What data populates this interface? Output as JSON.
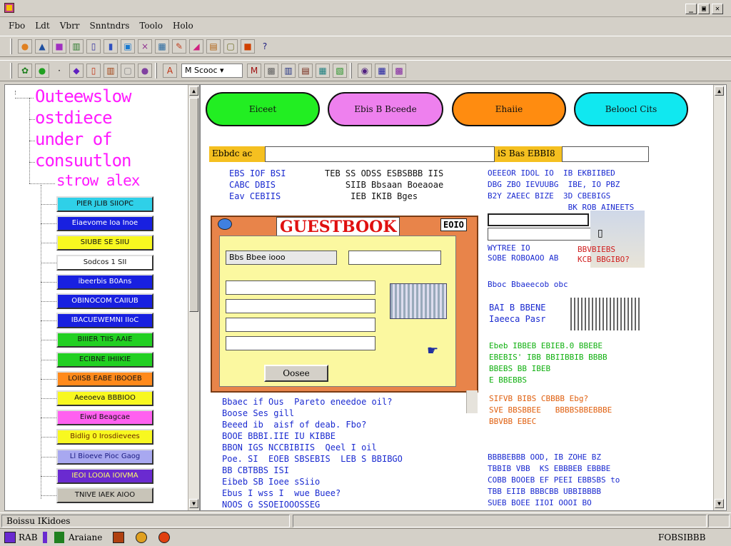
{
  "window": {
    "title": "",
    "minimize": "_",
    "maximize": "▣",
    "close": "✕"
  },
  "menu": [
    "Fbo",
    "Ldt",
    "Vbrr",
    "Snntndrs",
    "Toolo",
    "Holo"
  ],
  "toolbar1_icons": [
    "brush-icon",
    "disk-icon",
    "palette-icon",
    "book-icon",
    "page-icon",
    "doc-icon",
    "image-icon",
    "grid-icon",
    "paint-icon",
    "cursor-icon",
    "archive-icon",
    "scroll-icon",
    "box-icon",
    "pin-icon"
  ],
  "toolbar2": {
    "select_value": "Scooc",
    "select_prefix": "M"
  },
  "tree": {
    "titles": [
      "Outeewslow",
      "ostdiece",
      "under of",
      "consuutlon",
      "strow alex"
    ],
    "buttons": [
      {
        "label": "PIER JLIB SIIOPC",
        "bg": "#2fd0e8",
        "fg": "#111"
      },
      {
        "label": "Eiaevome Ioa Inoe",
        "bg": "#1820e0",
        "fg": "#ffffff"
      },
      {
        "label": "SIUBE SE SIIU",
        "bg": "#f8f820",
        "fg": "#111"
      },
      {
        "label": "Sodcos 1 SII",
        "bg": "#ffffff",
        "fg": "#111"
      },
      {
        "label": "ibeerbis B0Ans",
        "bg": "#1820e0",
        "fg": "#ffffff"
      },
      {
        "label": "OBINOCOM CAIIUB",
        "bg": "#1820e0",
        "fg": "#ffffff"
      },
      {
        "label": "IBACUEWEMNI IIoC",
        "bg": "#1820e0",
        "fg": "#ffffff"
      },
      {
        "label": "BIIIER TIIS AAIE",
        "bg": "#22d022",
        "fg": "#111"
      },
      {
        "label": "ECIBNE IHIIKIE",
        "bg": "#22d022",
        "fg": "#111"
      },
      {
        "label": "LOIISB EABE IBOOEB",
        "bg": "#ff8a1c",
        "fg": "#111"
      },
      {
        "label": "Aeeoeva BBBIOO",
        "bg": "#f8f820",
        "fg": "#111"
      },
      {
        "label": "Eiwd Beagcae",
        "bg": "#ff60f0",
        "fg": "#111"
      },
      {
        "label": "Bidlig 0 Irosdievees",
        "bg": "#f8f820",
        "fg": "#6a2a00"
      },
      {
        "label": "Ll Bioeve Pioc Gaog",
        "bg": "#a8a8f0",
        "fg": "#1a1a80"
      },
      {
        "label": "IEOI LOOIA IOIVMA",
        "bg": "#6a2ad0",
        "fg": "#ffff66"
      },
      {
        "label": "TNIVE IAEK AIOO",
        "bg": "#c8c4b8",
        "fg": "#111"
      }
    ]
  },
  "pills": [
    {
      "label": "Eiceet",
      "bg": "#22ee22"
    },
    {
      "label": "Ebis B Bceede",
      "bg": "#ee80ee"
    },
    {
      "label": "Ehaiie",
      "bg": "#ff8c10"
    },
    {
      "label": "Beloocl Cits",
      "bg": "#10e8f0"
    }
  ],
  "label_bar": {
    "left_label": "Ebbdc ac",
    "right_label": "iS Bas EBBI8"
  },
  "text_blocks": {
    "col1_a": "EBS IOF BSI\nCABC DBIS\nEav CEBIIS",
    "col2_a": "TEB SS ODSS ESBSBBB IIS\n    SIIB Bbsaan Boeaoae\n     IEB IKIB Bges",
    "col3_a": "OEEEOR IDOL IO  IB EKBIIBED\nDBG ZBO IEVUUBG  IBE, IO PBZ\nB2Y ZAEEC BIZE  3D CBEBIGS\n                 BK ROB AINEETS",
    "gb_title": "GUESTBOOK",
    "gb_badge": "EOIO",
    "gb_field": "Bbs Bbee iooo",
    "gb_button": "Oosee",
    "col1_b": "Bbaec if Ous  Pareto eneedoe oil?\nBoose Ses gill\nBeeed ib  aisf of deab. Fbo?\nBOOE BBBI.IIE IU KIBBE\nBBON IGS NCCBIBIIS  Qeel I oil\nPoe. SI  EOEB SBSEBIS  LEB S BBIBGO\nBB CBTBBS ISI\nEibeb SB Ioee sSiio\nEbus I wss I  wue Buee?\nNOOS G SSOEIOOOSSEG",
    "col3_b_top": "WYTREE IO\nSOBE ROBOAOO AB",
    "col3_b_red": "BBVBIEBS\nKCB BBGIBO?",
    "col3_b_mid": "Bboc Bbaeecob obc",
    "col3_c": "BAI B BBENE\nIaeeca Pasr",
    "col3_green": "Ebeb IBBEB EBIEB.0 BBEBE\nEBEBIS' IBB BBIIBBIB BBBB\nBBEBS BB IBEB\nE BBEBBS",
    "col3_orange": "SIFVB BIBS CBBBB Ebg?\nSVE BBSBBEE   BBBBSBBEBBBE\nBBVBB EBEC",
    "col3_blue": "BBBBEBBB OOD, IB ZOHE BZ\nTBBIB VBB  KS EBBBEB EBBBE\nCOBB BOOEB EF PEEI EBBSBS to\nTBB EIIB BBBCBB UBBIBBBB\nSUEB BOEE IIOI OOOI BO"
  },
  "status": {
    "left": "Boissu IKidoes",
    "right": "FOBSIBBB"
  },
  "taskbar": [
    "RAB",
    "Araiane"
  ]
}
